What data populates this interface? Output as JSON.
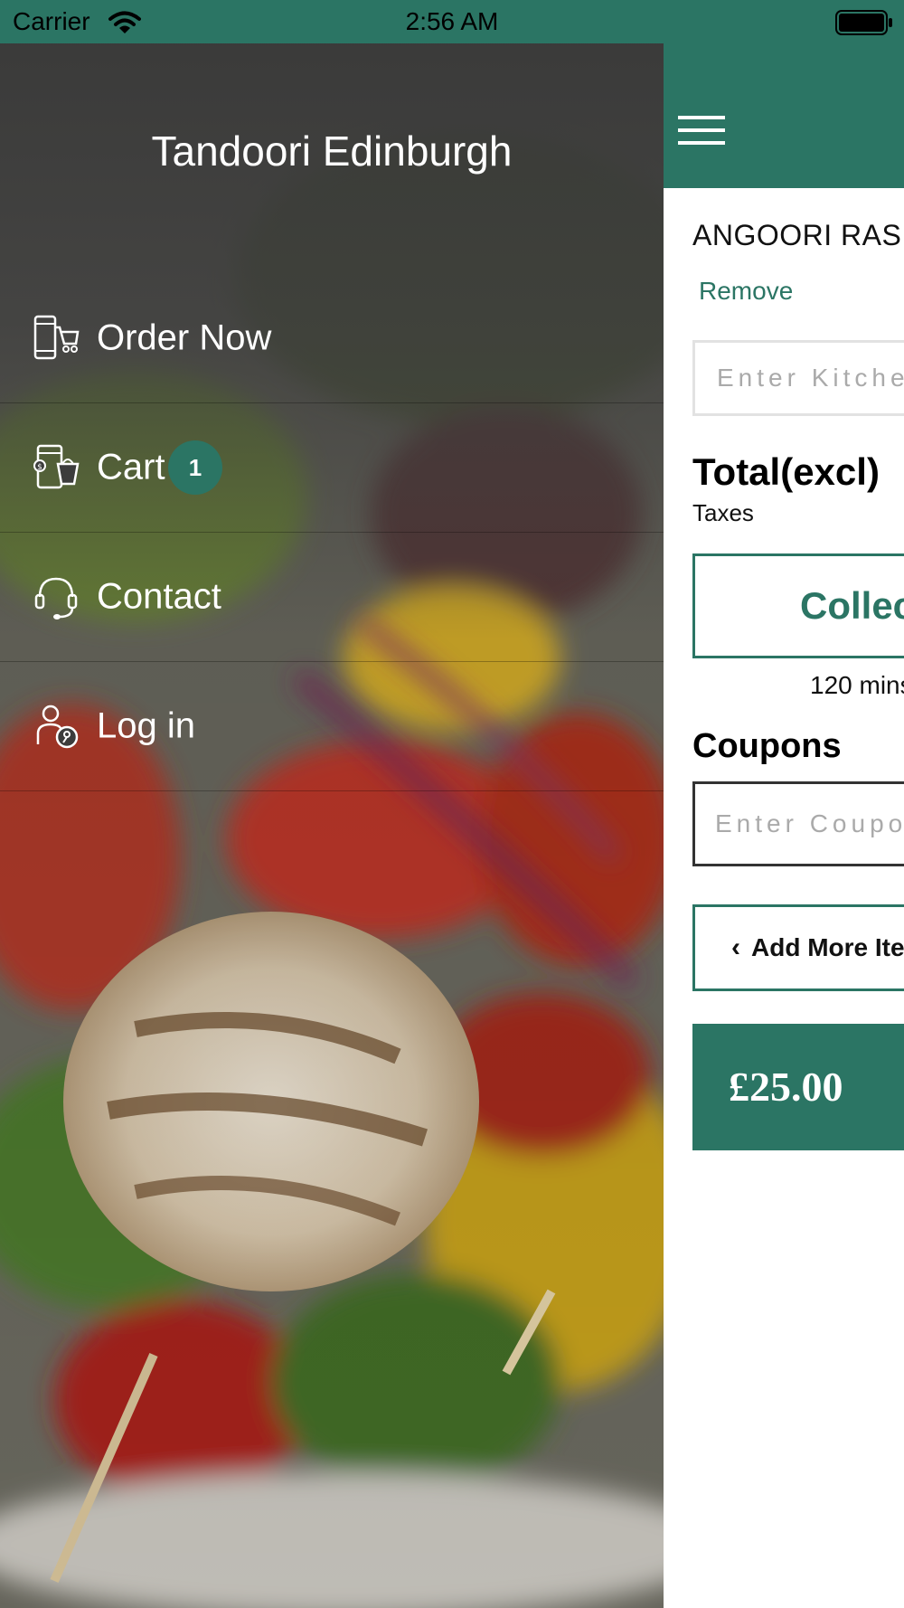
{
  "status_bar": {
    "carrier": "Carrier",
    "time": "2:56 AM"
  },
  "drawer": {
    "title": "Tandoori Edinburgh",
    "items": [
      {
        "label": "Order Now",
        "icon": "mobile-cart-icon"
      },
      {
        "label": "Cart",
        "icon": "mobile-shopping-basket-icon",
        "badge": "1"
      },
      {
        "label": "Contact",
        "icon": "headset-icon"
      },
      {
        "label": "Log in",
        "icon": "user-key-icon"
      }
    ]
  },
  "cart": {
    "item_name": "ANGOORI RASMALAI",
    "remove_label": "Remove",
    "kitchen_placeholder": "Enter Kitchen Notes",
    "total_label": "Total(excl)",
    "taxes_label": "Taxes",
    "collection_label": "Collection",
    "eta_text": "120 mins",
    "coupons_label": "Coupons",
    "coupon_placeholder": "Enter Coupon Code",
    "add_more_label": "Add More Items",
    "price": "£25.00"
  },
  "colors": {
    "brand": "#2b7564",
    "header": "#2b7564"
  }
}
